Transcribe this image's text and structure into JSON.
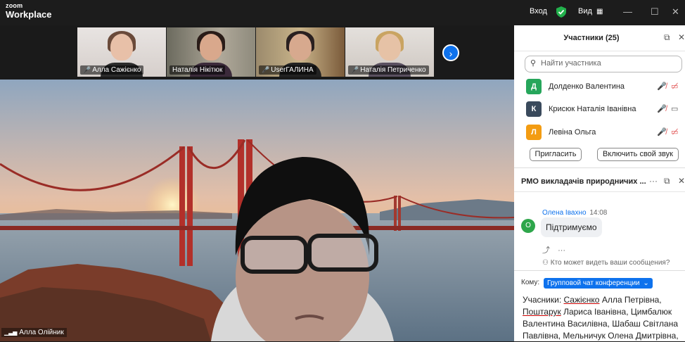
{
  "app": {
    "logo_top": "zoom",
    "logo_bottom": "Workplace",
    "signin_label": "Вход",
    "view_label": "Вид"
  },
  "thumbnails": [
    {
      "name": "Алла Сажієнко",
      "muted": true
    },
    {
      "name": "Наталія Нікітюк",
      "muted": false
    },
    {
      "name": "UserГАЛИНА",
      "muted": true
    },
    {
      "name": "Наталія Петриченко",
      "muted": true
    }
  ],
  "main_speaker": {
    "name": "Алла Олійник"
  },
  "participants": {
    "title": "Участники (25)",
    "search_placeholder": "Найти участника",
    "list": [
      {
        "initial": "Д",
        "name": "Долденко Валентина",
        "color": "#26a65b",
        "video": "off"
      },
      {
        "initial": "К",
        "name": "Крисюк Наталія Іванівна",
        "color": "#3a4a5c",
        "video": "on"
      },
      {
        "initial": "Л",
        "name": "Левіна Ольга",
        "color": "#f39c12",
        "video": "off"
      }
    ],
    "invite_label": "Пригласить",
    "unmute_label": "Включить свой звук"
  },
  "chat": {
    "title": "РМО викладачів природничих ...",
    "message": {
      "sender": "Олена Івахно",
      "time": "14:08",
      "initial": "О",
      "text": "Підтримуємо"
    },
    "visibility_note": "Кто может видеть ваши сообщения?",
    "to_label": "Кому:",
    "recipient": "Групповой чат конференции",
    "draft_prefix": "Учасники: ",
    "draft_name1": "Сажієнко",
    "draft_mid1": " Алла Петрівна, ",
    "draft_name2": "Поштарук",
    "draft_rest": " Лариса Іванівна, Цимбалюк Валентина Василівна, Шабаш Світлана Павлівна, Мельничук Олена Дмитрівна,"
  },
  "colors": {
    "accent": "#0e72ed",
    "mute": "#e04a4a"
  }
}
